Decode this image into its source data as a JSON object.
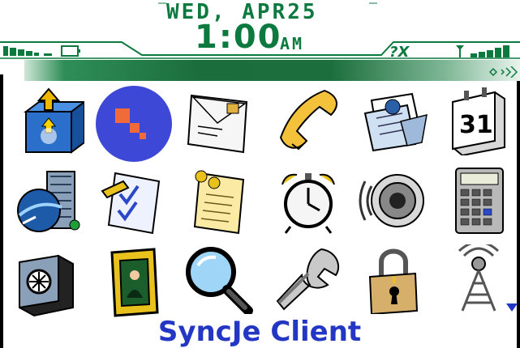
{
  "status": {
    "date": "WED, APR25",
    "time": "1:00",
    "ampm": "AM",
    "signal_label": "?X"
  },
  "selected_label": "SyncJe Client",
  "colors": {
    "accent_green": "#0c7a3f",
    "selection_blue": "#3e48d6",
    "label_blue": "#2437c4"
  },
  "icons": [
    {
      "name": "download-box-icon"
    },
    {
      "name": "syncje-client-icon"
    },
    {
      "name": "mail-envelope-icon"
    },
    {
      "name": "phone-icon"
    },
    {
      "name": "spreadsheet-envelopes-icon"
    },
    {
      "name": "calendar-icon"
    },
    {
      "name": "browser-globe-icon"
    },
    {
      "name": "tasks-checklist-icon"
    },
    {
      "name": "memo-pad-icon"
    },
    {
      "name": "alarm-clock-icon"
    },
    {
      "name": "speaker-icon"
    },
    {
      "name": "calculator-icon"
    },
    {
      "name": "options-safe-icon"
    },
    {
      "name": "picture-frame-icon"
    },
    {
      "name": "search-magnifier-icon"
    },
    {
      "name": "wrench-icon"
    },
    {
      "name": "padlock-icon"
    },
    {
      "name": "antenna-tower-icon"
    }
  ]
}
